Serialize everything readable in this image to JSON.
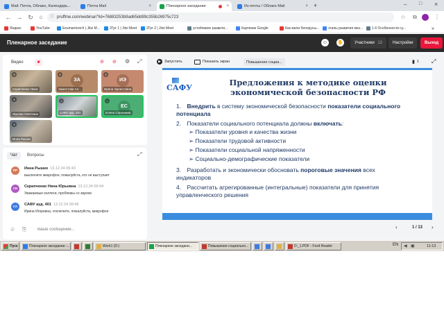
{
  "browser": {
    "tabs": [
      {
        "label": "Mail: Почта, Облако, Календарь...",
        "favicon_color": "#2b7de9"
      },
      {
        "label": "Почта Mail",
        "favicon_color": "#2b7de9"
      },
      {
        "label": "Пленарное заседание",
        "favicon_color": "#16a34a",
        "active": true
      },
      {
        "label": "Из почты / Облако Mail",
        "favicon_color": "#2b7de9"
      }
    ],
    "url": "pruffme.com/webinar/?id=76883253b9ad65dd89c355b26975c723",
    "bookmarks": [
      {
        "label": "Яндекс",
        "color": "#e53935"
      },
      {
        "label": "YouTube",
        "color": "#e53935"
      },
      {
        "label": "Eesmantovich | Jitsi M...",
        "color": "#1e88e5"
      },
      {
        "label": "2Грг 1 | Jitsi Meet",
        "color": "#1e88e5"
      },
      {
        "label": "2Грг 2 | Jitsi Meet",
        "color": "#1e88e5"
      },
      {
        "label": "устойчивое развити...",
        "color": "#607d8b"
      },
      {
        "label": "Картинки Google",
        "color": "#4285f4"
      },
      {
        "label": "Как жили белорусы...",
        "color": "#e53935"
      },
      {
        "label": "этапы развития мез...",
        "color": "#4285f4"
      },
      {
        "label": "1.4 Особенности су...",
        "color": "#607d8b"
      }
    ]
  },
  "app": {
    "title": "Пленарное заседание",
    "participants_label": "Участники",
    "participants_count": "13",
    "settings_label": "Настройки",
    "exit_label": "Выход"
  },
  "video": {
    "title": "Видео",
    "tiles": [
      {
        "name": "Скрипченко Нина",
        "kind": "photo"
      },
      {
        "name": "Заместова Ал...",
        "kind": "avatar",
        "initials": "ЗА",
        "color": "#b78b6a"
      },
      {
        "name": "Ирина Эрнестовна",
        "kind": "avatar",
        "initials": "ИЭ",
        "color": "#c4896f"
      },
      {
        "name": "Жукова Светлана",
        "kind": "photo"
      },
      {
        "name": "САФУ ауд. 401",
        "kind": "photo",
        "speaking": true
      },
      {
        "name": "Елена Сергеевна",
        "kind": "avatar",
        "initials": "ЕС",
        "color": "#4cae74",
        "speaking": true
      },
      {
        "name": "Инна Рышко",
        "kind": "photo"
      }
    ]
  },
  "chat": {
    "tabs": [
      "Чат",
      "Вопросы"
    ],
    "messages": [
      {
        "initials": "РР",
        "color": "#d47a5a",
        "author": "Инна Рышко",
        "time": "13.12.24 09:43",
        "text": "выключите микрофон, пожалуйста, кто не выступает"
      },
      {
        "initials": "СН",
        "color": "#b05ac2",
        "author": "Скрипченко Нина Юрьевна",
        "time": "13.12.24 09:44",
        "text": "Уважаемые коллеги, проблемы со звуком"
      },
      {
        "initials": "СА",
        "color": "#3d7be0",
        "author": "САФУ ауд. 401",
        "time": "13.12.24 09:46",
        "text": "Ирина Игоревна, отключите, пожалуйста, микрофон"
      }
    ],
    "input_placeholder": "Ваше сообщение..."
  },
  "toolbar": {
    "start_label": "Запустить",
    "share_label": "Показать экран",
    "upload_label": "Повышение социа...",
    "bookmark_count": "1"
  },
  "slide": {
    "logo": "САФУ",
    "title": "Предложения к методике оценки экономической безопасности РФ",
    "points": [
      {
        "num": "1.",
        "pre": "Внедрить",
        "mid": " в систему экономической безопасности ",
        "bold": "показатели социального потенциала"
      },
      {
        "num": "2.",
        "text": "Показатели социального потенциала должны ",
        "bold": "включать",
        "post": ":"
      },
      {
        "num": "3.",
        "text": "Разработать и экономически обосновать ",
        "bold": "пороговые значения",
        "post": " всех индикаторов"
      },
      {
        "num": "4.",
        "text": "Рассчитать агрегированные (интегральные) показатели для принятия управленческого решения"
      }
    ],
    "subpoints": [
      "Показатели уровня и качества жизни",
      "Показатели трудовой активности",
      "Показатели социальной напряженности",
      "Социально-демографические показатели"
    ],
    "page": "1 / 13"
  },
  "taskbar": {
    "start": "Пуск",
    "items": [
      {
        "label": "Пленарное заседание -...",
        "color": "#2b7de9"
      },
      {
        "label": "",
        "color": "#c0392b"
      },
      {
        "label": "",
        "color": "#2e7d32"
      },
      {
        "label": "Work1 (D:)",
        "color": "#e0b040"
      },
      {
        "label": "Пленарное заседани...",
        "color": "#16a34a",
        "pressed": true
      },
      {
        "label": "Повышение социально...",
        "color": "#c0392b"
      },
      {
        "label": "",
        "color": "#3d7be0"
      },
      {
        "label": "",
        "color": "#3d7be0"
      },
      {
        "label": "",
        "color": "#e0b040"
      },
      {
        "label": "D:_1.PDF - Foxit Reader",
        "color": "#c0392b"
      }
    ],
    "lang": "EN",
    "time": "11:13"
  }
}
